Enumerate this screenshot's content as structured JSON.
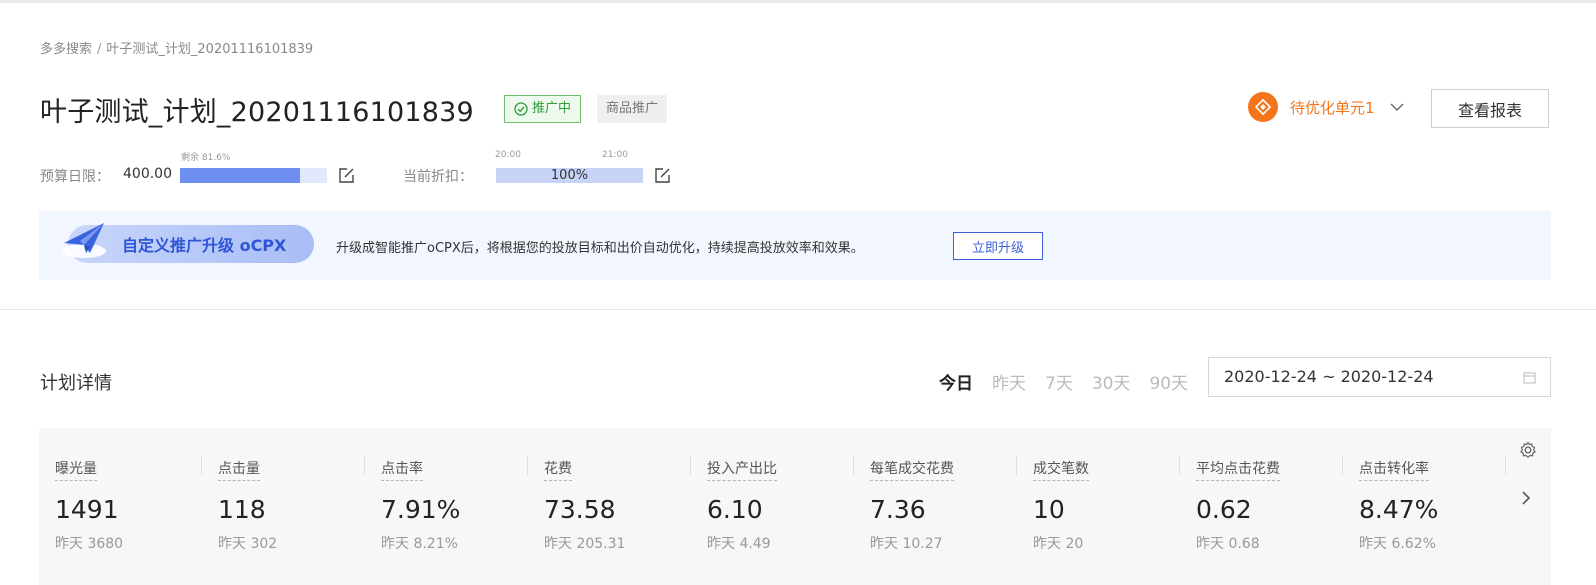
{
  "breadcrumb": {
    "root": "多多搜索",
    "separator": "/",
    "current": "叶子测试_计划_20201116101839"
  },
  "plan": {
    "title": "叶子测试_计划_20201116101839",
    "status": "推广中",
    "type": "商品推广"
  },
  "header_actions": {
    "optimize_label": "待优化单元1",
    "report_button": "查看报表"
  },
  "budget": {
    "label": "预算日限：",
    "value": "400.00",
    "remaining_label": "剩余 81.6%",
    "remaining_fraction": 0.816
  },
  "discount": {
    "label": "当前折扣：",
    "time_start": "20:00",
    "time_end": "21:00",
    "value": "100%"
  },
  "banner": {
    "pill_text": "自定义推广升级 oCPX",
    "description": "升级成智能推广oCPX后，将根据您的投放目标和出价自动优化，持续提高投放效率和效果。",
    "button": "立即升级"
  },
  "details": {
    "title": "计划详情",
    "date_tabs": [
      "今日",
      "昨天",
      "7天",
      "30天",
      "90天"
    ],
    "active_tab": "今日",
    "date_range": "2020-12-24 ~ 2020-12-24"
  },
  "metrics": [
    {
      "name": "曝光量",
      "value": "1491",
      "prev": "昨天 3680"
    },
    {
      "name": "点击量",
      "value": "118",
      "prev": "昨天 302"
    },
    {
      "name": "点击率",
      "value": "7.91%",
      "prev": "昨天 8.21%"
    },
    {
      "name": "花费",
      "value": "73.58",
      "prev": "昨天 205.31"
    },
    {
      "name": "投入产出比",
      "value": "6.10",
      "prev": "昨天 4.49"
    },
    {
      "name": "每笔成交花费",
      "value": "7.36",
      "prev": "昨天 10.27"
    },
    {
      "name": "成交笔数",
      "value": "10",
      "prev": "昨天 20"
    },
    {
      "name": "平均点击花费",
      "value": "0.62",
      "prev": "昨天 0.68"
    },
    {
      "name": "点击转化率",
      "value": "8.47%",
      "prev": "昨天 6.62%"
    }
  ],
  "colors": {
    "accent_blue": "#3d5fd8",
    "status_green": "#2f9e3a",
    "warning_orange": "#f5761a"
  }
}
